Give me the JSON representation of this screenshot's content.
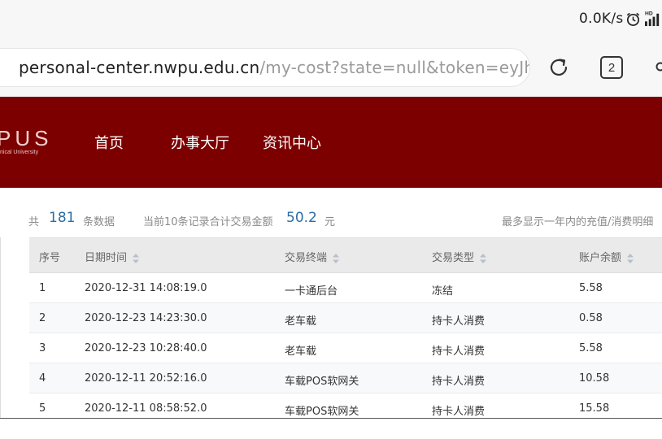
{
  "status_bar": {
    "net_speed": "0.0K/s",
    "signal_badge": "HD"
  },
  "browser": {
    "url_domain": "personal-center.nwpu.edu.cn",
    "url_path": "/my-cost?state=null&token=eyJh",
    "tab_count": "2"
  },
  "site": {
    "logo_text": "PUS",
    "logo_sub": "nical University",
    "brand_color": "#7d0000",
    "nav": [
      "首页",
      "办事大厅",
      "资讯中心"
    ]
  },
  "summary": {
    "prefix": "共",
    "total_count": "181",
    "count_suffix": "条数据",
    "amount_label": "当前10条记录合计交易金额",
    "amount_value": "50.2",
    "amount_unit": "元",
    "note": "最多显示一年内的充值/消费明细"
  },
  "table": {
    "columns": [
      "序号",
      "日期时间",
      "交易终端",
      "交易类型",
      "账户余额"
    ],
    "rows": [
      [
        "1",
        "2020-12-31 14:08:19.0",
        "一卡通后台",
        "冻结",
        "5.58"
      ],
      [
        "2",
        "2020-12-23 14:23:30.0",
        "老车载",
        "持卡人消费",
        "0.58"
      ],
      [
        "3",
        "2020-12-23 10:28:40.0",
        "老车载",
        "持卡人消费",
        "5.58"
      ],
      [
        "4",
        "2020-12-11 20:52:16.0",
        "车载POS软网关",
        "持卡人消费",
        "10.58"
      ],
      [
        "5",
        "2020-12-11 08:58:52.0",
        "车载POS软网关",
        "持卡人消费",
        "15.58"
      ]
    ]
  }
}
